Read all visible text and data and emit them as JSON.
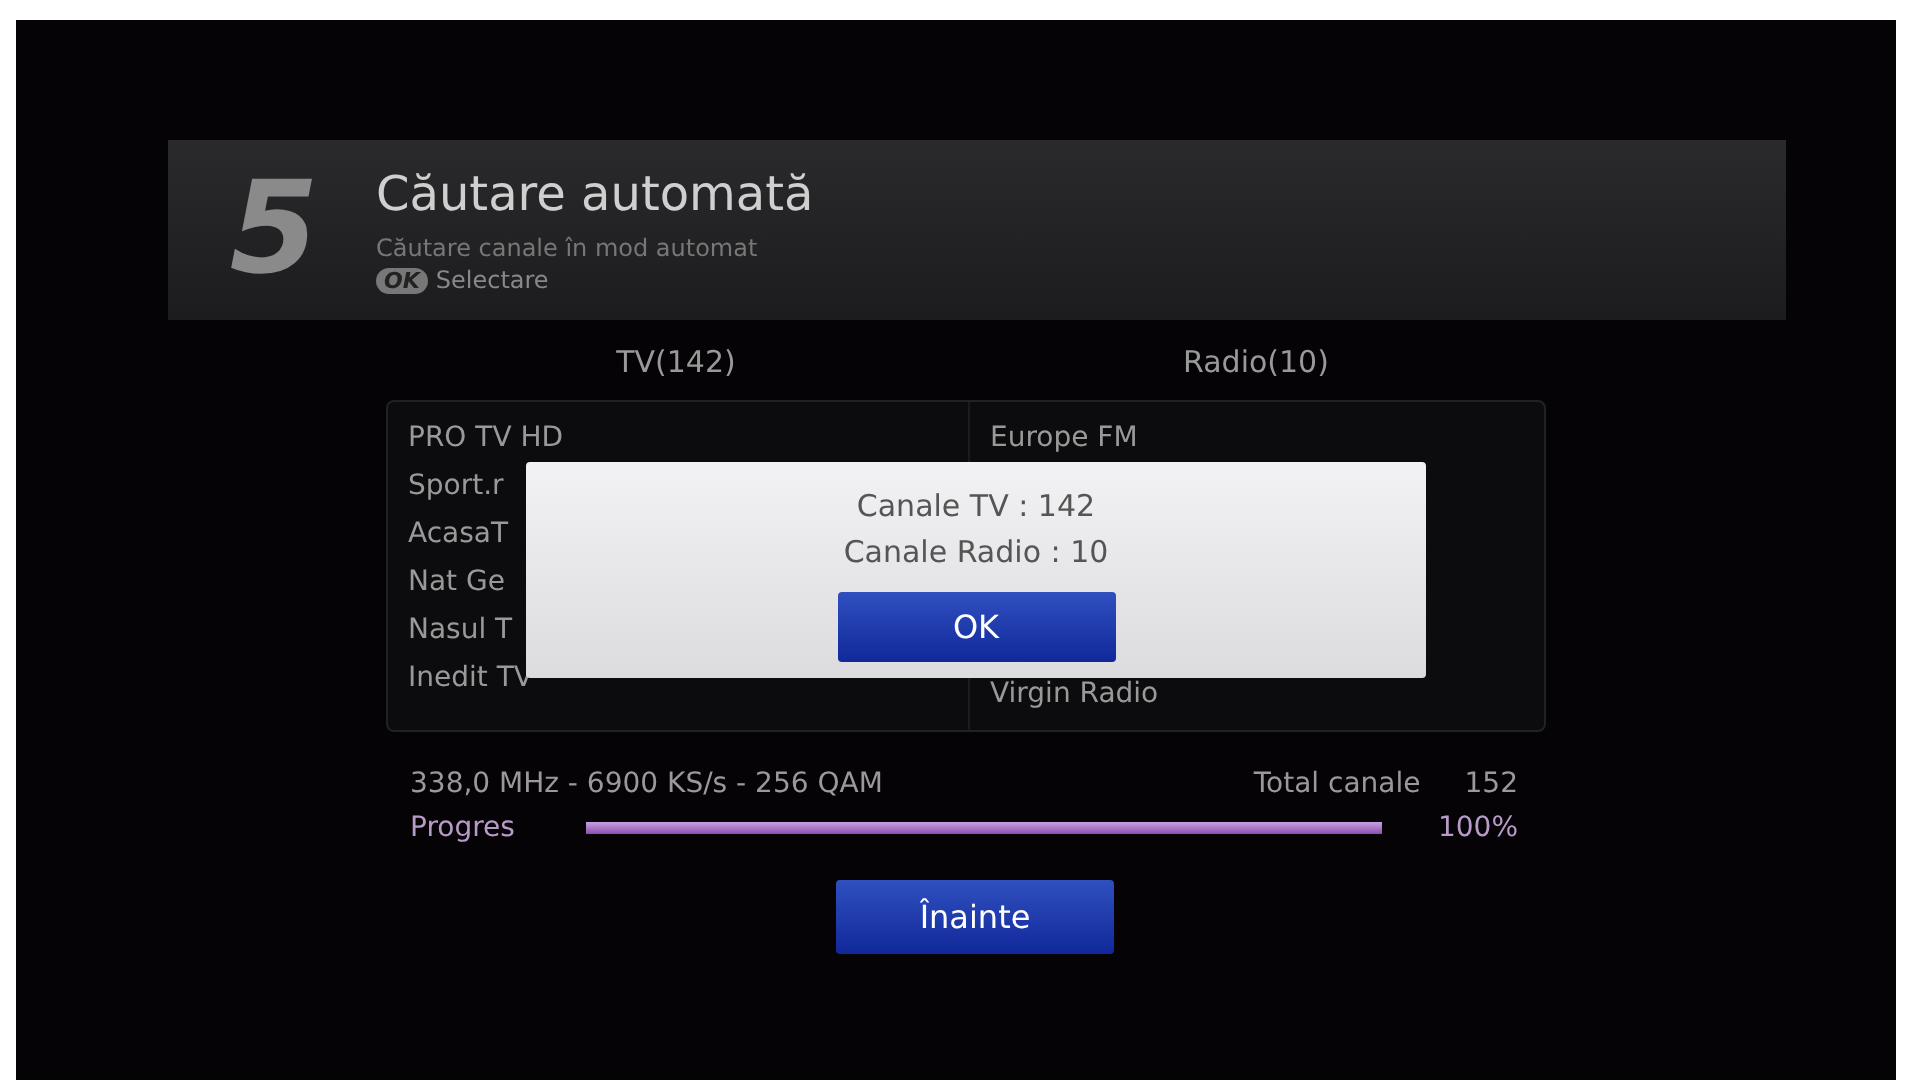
{
  "header": {
    "step": "5",
    "title": "Căutare automată",
    "subtitle": "Căutare canale în mod automat",
    "hint_key": "OK",
    "hint_label": "Selectare"
  },
  "columns": [
    {
      "heading": "TV(142)",
      "items": [
        "PRO TV HD",
        "Sport.r",
        "AcasaT",
        "Nat Ge",
        "Nasul T",
        "Inedit TV"
      ]
    },
    {
      "heading": "Radio(10)",
      "items": [
        "Europe FM",
        "Virgin Radio"
      ]
    }
  ],
  "dialog": {
    "lines": [
      "Canale TV : 142",
      "Canale Radio : 10"
    ],
    "button": "OK"
  },
  "scan": {
    "frequency": "338,0 MHz - 6900 KS/s - 256 QAM",
    "total_label": "Total canale",
    "total_value": "152",
    "progress_label": "Progres",
    "level": 1,
    "percent": "100%"
  },
  "next_button": "Înainte"
}
